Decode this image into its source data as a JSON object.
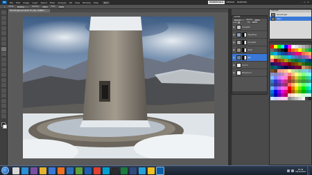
{
  "app": {
    "logo": "Ps",
    "menu": [
      "File",
      "Edit",
      "Image",
      "Layer",
      "Select",
      "Filter",
      "Analysis",
      "3D",
      "View",
      "Window",
      "Help"
    ],
    "zoom": "66.7",
    "workspaces": [
      "ESSENTIALS",
      "DESIGN",
      "PAINTING"
    ],
    "active_workspace": "ESSENTIALS",
    "window_controls": [
      "–",
      "▫",
      "✕"
    ]
  },
  "options": {
    "brush_size": "•",
    "mode_label": "Mode:",
    "mode_value": "Multiply",
    "opacity_label": "Opacity:",
    "opacity_value": "100%",
    "flow_label": "Flow:",
    "flow_value": "100%"
  },
  "document": {
    "tab_title": "StoneTurget.psd @ 66.7% (Sky, RGB/8) *"
  },
  "layers": {
    "title": "LAYERS",
    "blend_mode": "Normal",
    "opacity_label": "Opacity:",
    "opacity_value": "100%",
    "lock_label": "Lock:",
    "fill_label": "Fill:",
    "fill_value": "100%",
    "items": [
      {
        "name": "Grungebit",
        "has_mask": false,
        "selected": false,
        "thumb": "#bfbfbf"
      },
      {
        "name": "Page Blues",
        "has_mask": true,
        "selected": false,
        "thumb": "#8fa0b8"
      },
      {
        "name": "Grungebit",
        "has_mask": true,
        "selected": false,
        "thumb": "#a8a8a8"
      },
      {
        "name": "Tower",
        "has_mask": true,
        "selected": false,
        "thumb": "#9a9080"
      },
      {
        "name": "Sky",
        "has_mask": true,
        "selected": true,
        "thumb": "#6a86a8"
      },
      {
        "name": "Ground",
        "has_mask": false,
        "selected": false,
        "thumb": "#e8eef4"
      },
      {
        "name": "Background",
        "has_mask": false,
        "selected": false,
        "thumb": "#ffffff"
      }
    ]
  },
  "history": {
    "title": "HISTORY",
    "items": [
      {
        "name": "StoneTurget",
        "selected": false
      },
      {
        "name": "Open",
        "selected": true
      }
    ]
  },
  "swatches": {
    "colors": [
      "#ff0000",
      "#ffff00",
      "#00ff00",
      "#00ffff",
      "#0000ff",
      "#ff00ff",
      "#ffffff",
      "#e6e6e6",
      "#cccccc",
      "#b3b3b3",
      "#999999",
      "#808080",
      "#666666",
      "#4d4d4d",
      "#333333",
      "#1a1a1a",
      "#000000",
      "#ed1c24",
      "#f26522",
      "#f7941d",
      "#fff200",
      "#8dc63f",
      "#39b54a",
      "#00a651",
      "#00a99d",
      "#00aeef",
      "#0072bc",
      "#0054a6",
      "#2e3192",
      "#662d91",
      "#92278f",
      "#ec008c",
      "#ed145b",
      "#f26c4f",
      "#f68e56",
      "#fbaf5d",
      "#fff568",
      "#acd372",
      "#7cc576",
      "#3bb878",
      "#1abbb4",
      "#00bff3",
      "#438ccb",
      "#5574b9",
      "#605ca8",
      "#855fa8",
      "#a763a8",
      "#f06ea9",
      "#f26d7d",
      "#9e0b0f",
      "#a0410d",
      "#a36209",
      "#aba000",
      "#598527",
      "#1a7b30",
      "#007236",
      "#00746b",
      "#0076a3",
      "#004b80",
      "#003471",
      "#1b1464",
      "#440e62",
      "#630460",
      "#9e005d",
      "#9e0039",
      "#790000",
      "#7b2e00",
      "#7d4900",
      "#827b00",
      "#406618",
      "#005e20",
      "#005826",
      "#005952",
      "#005b7f",
      "#003663",
      "#002157",
      "#0d004c",
      "#32004b",
      "#4b0049",
      "#7b0046",
      "#7a0026",
      "#c69c6d",
      "#a67c52",
      "#8c6239",
      "#754c24",
      "#603913",
      "#f5989d",
      "#f9ad81",
      "#fdc68a",
      "#fff799",
      "#c4df9b",
      "#a3d39c",
      "#82ca9d",
      "#7bcdc8",
      "#6ecff6",
      "#7ea7d8",
      "#8493ca",
      "#8882be",
      "#a186be",
      "#bd8cbf",
      "#f49ac1",
      "#ff8080",
      "#ffbf80",
      "#ffff80",
      "#bfff80",
      "#80ff80",
      "#80ffbf",
      "#80ffff",
      "#80bfff",
      "#8080ff",
      "#bf80ff",
      "#ff80ff",
      "#ff80bf",
      "#cc3333",
      "#cc7a33",
      "#cccc33",
      "#7acc33",
      "#33cc33",
      "#33cc7a",
      "#33cccc",
      "#337acc",
      "#3333cc",
      "#7a33cc",
      "#cc33cc",
      "#cc337a",
      "#993333",
      "#995c33",
      "#999933",
      "#5c9933",
      "#339933",
      "#33995c",
      "#339999",
      "#335c99",
      "#333399",
      "#5c3399",
      "#993399",
      "#99335c",
      "#ff6666",
      "#ffb366",
      "#ffff66",
      "#b3ff66",
      "#66ff66",
      "#66ffb3",
      "#66ffff",
      "#66b3ff",
      "#6666ff",
      "#b366ff",
      "#ff66ff",
      "#ff66b3",
      "#e60000",
      "#e67300",
      "#e6e600",
      "#73e600",
      "#00e600",
      "#00e673",
      "#00e6e6",
      "#0073e6",
      "#0000e6",
      "#7300e6",
      "#e600e6",
      "#e60073",
      "#b30000",
      "#b35900",
      "#b3b300",
      "#59b300",
      "#00b300",
      "#00b359",
      "#00b3b3",
      "#0059b3",
      "#0000b3",
      "#5900b3",
      "#b300b3",
      "#b30059",
      "#ffcccc",
      "#ffe6cc",
      "#ffffcc",
      "#e6ffcc",
      "#ccffcc",
      "#ccffe6",
      "#ccffff",
      "#cce6ff",
      "#ccccff",
      "#e6ccff",
      "#ffccff",
      "#ffcce6",
      "#8c8c8c",
      "#a6a6a6",
      "#bfbfbf",
      "#d9d9d9",
      "#f2f2f2",
      "#404040",
      "#262626"
    ]
  },
  "taskbar": {
    "apps": [
      "#d8d8d8",
      "#2d8fd5",
      "#7b4fa0",
      "#e8b130",
      "#3a78d6",
      "#f07020",
      "#2a6fb5",
      "#5fa03a",
      "#1c5fb0",
      "#e04030",
      "#00a0d0",
      "#2a2a2a",
      "#1b7a3a",
      "#304a7a",
      "#26a0da",
      "#f0c020",
      "#0a5fa8"
    ],
    "active_app_index": 16,
    "time": "20:35",
    "date": "30/11/2012"
  },
  "colors": {
    "accent": "#3a78d6",
    "ps_blue": "#0a5fa8"
  }
}
